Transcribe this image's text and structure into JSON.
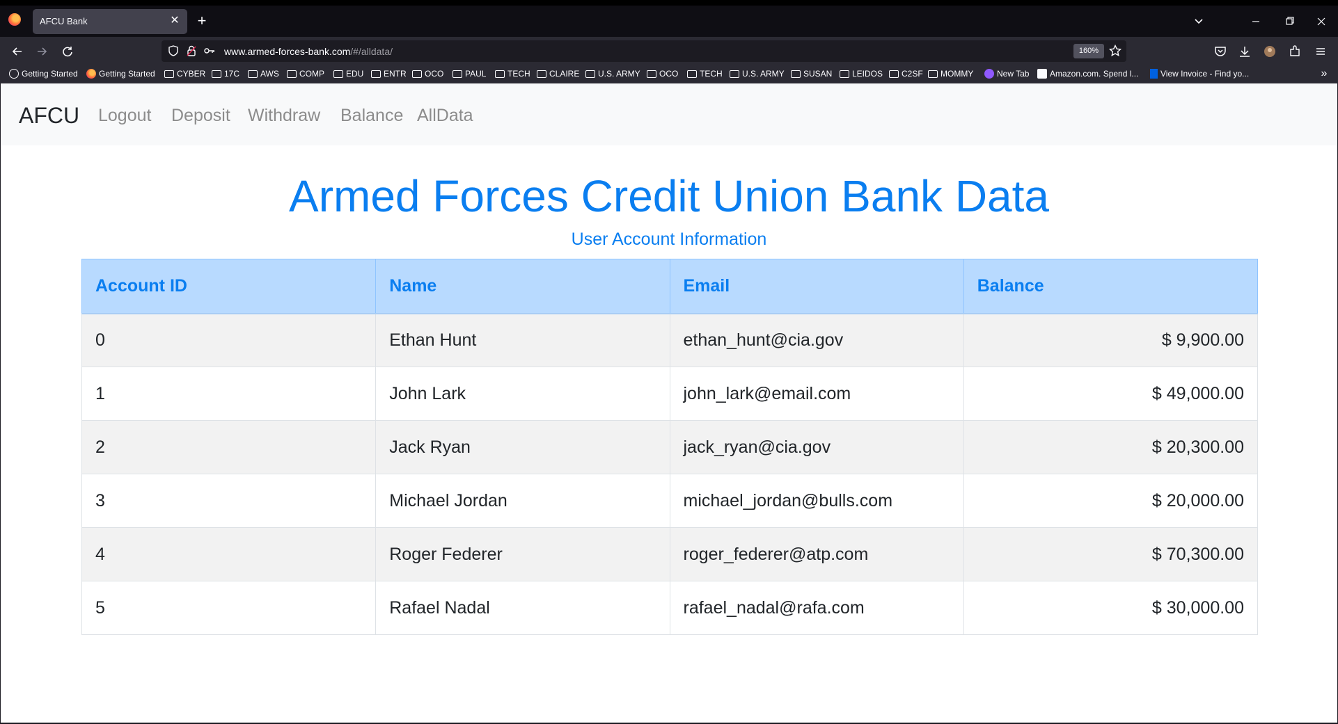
{
  "browser": {
    "tab_title": "AFCU Bank",
    "tab_close": "✕",
    "new_tab": "+",
    "url_host": "www.armed-forces-bank.com",
    "url_path": "/#/alldata/",
    "zoom": "160%",
    "bookmarks": [
      "Getting Started",
      "Getting Started",
      "CYBER",
      "17C",
      "AWS",
      "COMP",
      "EDU",
      "ENTR",
      "OCO",
      "PAUL",
      "TECH",
      "CLAIRE",
      "U.S. ARMY",
      "OCO",
      "TECH",
      "U.S. ARMY",
      "SUSAN",
      "LEIDOS",
      "C2SF",
      "MOMMY",
      "New Tab",
      "Amazon.com. Spend l...",
      "View Invoice - Find yo..."
    ]
  },
  "app": {
    "brand": "AFCU",
    "nav": [
      "Logout",
      "Deposit",
      "Withdraw",
      "Balance",
      "AllData"
    ],
    "title": "Armed Forces Credit Union Bank Data",
    "subtitle": "User Account Information"
  },
  "table": {
    "headers": [
      "Account ID",
      "Name",
      "Email",
      "Balance"
    ],
    "rows": [
      [
        "0",
        "Ethan Hunt",
        "ethan_hunt@cia.gov",
        "$ 9,900.00"
      ],
      [
        "1",
        "John Lark",
        "john_lark@email.com",
        "$ 49,000.00"
      ],
      [
        "2",
        "Jack Ryan",
        "jack_ryan@cia.gov",
        "$ 20,300.00"
      ],
      [
        "3",
        "Michael Jordan",
        "michael_jordan@bulls.com",
        "$ 20,000.00"
      ],
      [
        "4",
        "Roger Federer",
        "roger_federer@atp.com",
        "$ 70,300.00"
      ],
      [
        "5",
        "Rafael Nadal",
        "rafael_nadal@rafa.com",
        "$ 30,000.00"
      ]
    ]
  },
  "colors": {
    "accent": "#0a7ef0",
    "header_bg": "#b8daff",
    "stripe": "#f2f2f2"
  },
  "icons": [
    "firefox-logo-icon",
    "back-icon",
    "forward-icon",
    "reload-icon",
    "shield-icon",
    "lock-icon",
    "key-icon",
    "star-icon",
    "pocket-icon",
    "download-icon",
    "account-icon",
    "extensions-icon",
    "menu-icon",
    "folder-icon",
    "globe-icon"
  ]
}
